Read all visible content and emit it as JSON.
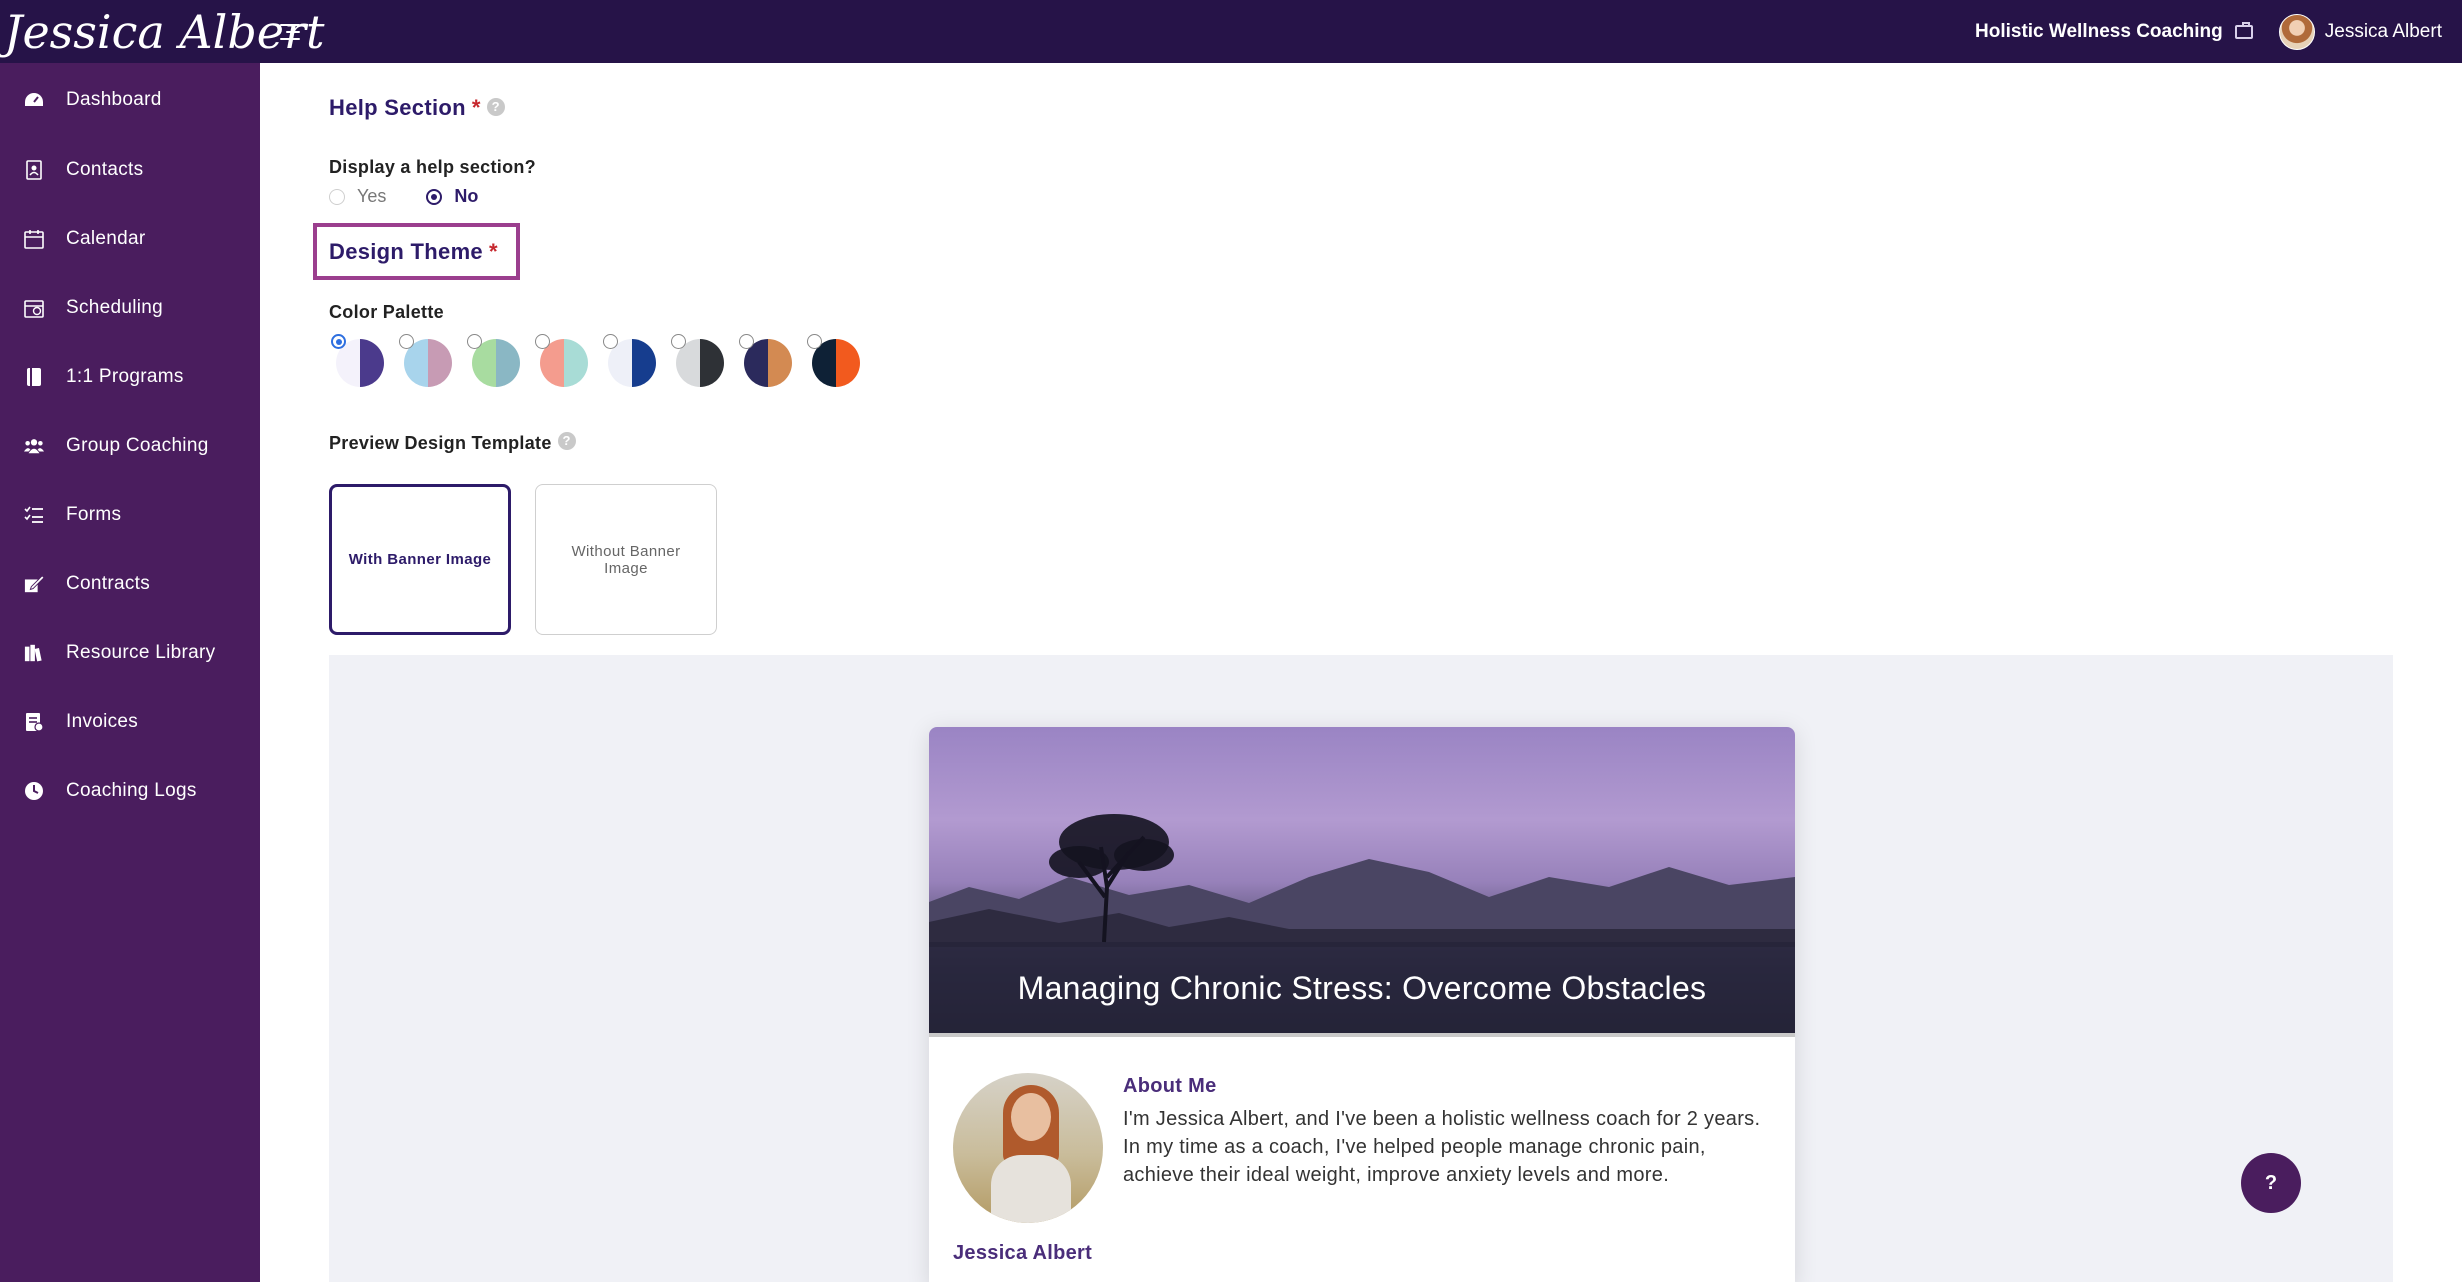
{
  "header": {
    "logo_text": "Jessica Albert",
    "business_name": "Holistic Wellness Coaching",
    "user_name": "Jessica Albert"
  },
  "sidebar": {
    "items": [
      {
        "label": "Dashboard",
        "icon": "dashboard-icon"
      },
      {
        "label": "Contacts",
        "icon": "contacts-icon"
      },
      {
        "label": "Calendar",
        "icon": "calendar-icon"
      },
      {
        "label": "Scheduling",
        "icon": "scheduling-icon"
      },
      {
        "label": "1:1 Programs",
        "icon": "book-icon"
      },
      {
        "label": "Group Coaching",
        "icon": "group-icon"
      },
      {
        "label": "Forms",
        "icon": "list-icon"
      },
      {
        "label": "Contracts",
        "icon": "signature-icon"
      },
      {
        "label": "Resource Library",
        "icon": "library-icon"
      },
      {
        "label": "Invoices",
        "icon": "invoice-icon"
      },
      {
        "label": "Coaching Logs",
        "icon": "clock-icon"
      }
    ]
  },
  "help_section": {
    "title": "Help Section",
    "required_mark": "*",
    "help_icon": "?",
    "question": "Display a help section?",
    "options": [
      {
        "label": "Yes",
        "selected": false
      },
      {
        "label": "No",
        "selected": true
      }
    ]
  },
  "design_theme": {
    "title": "Design Theme",
    "required_mark": "*",
    "color_palette_label": "Color Palette",
    "palettes": [
      {
        "left": "#f4f2fb",
        "right": "#4b3a8c",
        "selected": true
      },
      {
        "left": "#a8d4ec",
        "right": "#c79bb4",
        "selected": false
      },
      {
        "left": "#a8dca0",
        "right": "#8ab7c4",
        "selected": false
      },
      {
        "left": "#f49c8e",
        "right": "#a8dcd6",
        "selected": false
      },
      {
        "left": "#eef0f8",
        "right": "#163d8e",
        "selected": false
      },
      {
        "left": "#d8dadc",
        "right": "#2e3136",
        "selected": false
      },
      {
        "left": "#2b2a5c",
        "right": "#d38a52",
        "selected": false
      },
      {
        "left": "#0e2136",
        "right": "#f25a1e",
        "selected": false
      }
    ],
    "preview_label": "Preview Design Template",
    "help_icon": "?",
    "templates": [
      {
        "label": "With Banner Image",
        "selected": true
      },
      {
        "label": "Without Banner Image",
        "selected": false
      }
    ]
  },
  "preview": {
    "banner_title": "Managing Chronic Stress: Overcome Obstacles",
    "about_title": "About Me",
    "about_text": "I'm Jessica Albert, and I've been a holistic wellness coach for 2 years. In my time as a coach, I've helped people manage chronic pain, achieve their ideal weight, improve anxiety levels and more.",
    "profile_name": "Jessica Albert"
  },
  "help_fab": {
    "label": "?"
  }
}
